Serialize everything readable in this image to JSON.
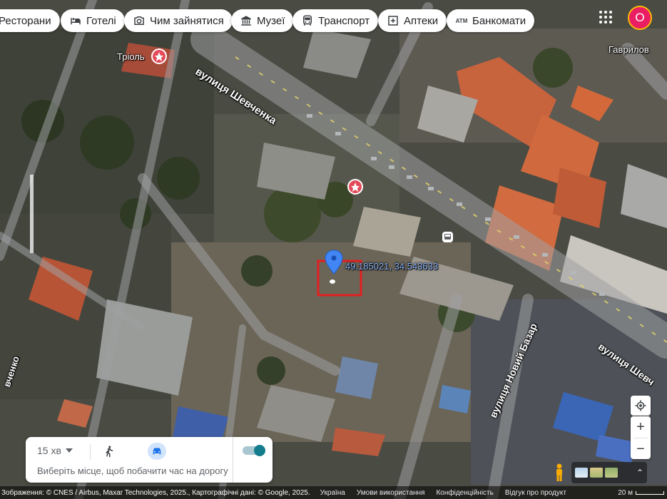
{
  "categories": [
    {
      "label": "Ресторани",
      "icon": "restaurant-icon"
    },
    {
      "label": "Готелі",
      "icon": "hotel-bed-icon"
    },
    {
      "label": "Чим зайнятися",
      "icon": "camera-icon"
    },
    {
      "label": "Музеї",
      "icon": "museum-icon"
    },
    {
      "label": "Транспорт",
      "icon": "transit-icon"
    },
    {
      "label": "Аптеки",
      "icon": "pharmacy-icon"
    },
    {
      "label": "Банкомати",
      "icon": "atm-icon",
      "icon_text": "ATM"
    }
  ],
  "account": {
    "initial": "О",
    "color": "#e91e63"
  },
  "map_labels": {
    "poi_trioll": "Тріоль",
    "poi_gavrylov": "Гаврилов",
    "street_shevchenka": "вулиця Шевченка",
    "street_novyi_bazar": "вулиця Новий Базар",
    "street_shevch_right": "вулиця Шевч",
    "street_left_cut": "вченко"
  },
  "pin": {
    "coordinates": "49.185021, 34.543633",
    "color": "#4285f4"
  },
  "selection_box_color": "#e02020",
  "directions": {
    "duration": "15 хв",
    "hint": "Виберіть місце, щоб побачити час на дорогу",
    "active_mode": "driving"
  },
  "footer": {
    "imagery": "Зображення: © CNES / Airbus, Maxar Technologies, 2025., Картографічні дані: © Google, 2025.",
    "country": "Україна",
    "terms": "Умови використання",
    "privacy": "Конфіденційність",
    "feedback": "Відгук про продукт",
    "scale": "20 м"
  },
  "colors": {
    "brand_blue": "#1a73e8",
    "toggle_teal": "#137d8d"
  }
}
